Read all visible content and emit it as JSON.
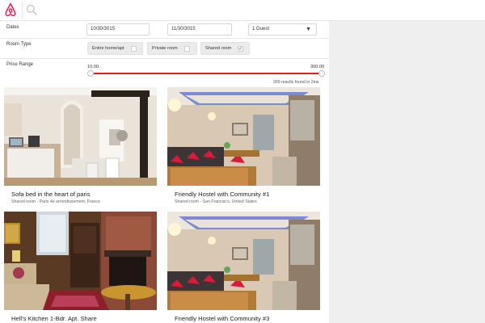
{
  "app": {
    "logo_icon": "airbnb-logo-icon",
    "search_icon": "search-icon",
    "accent_color": "#e02020"
  },
  "filters": {
    "dates": {
      "label": "Dates",
      "check_in": "10/30/3015",
      "check_out": "11/30/3015",
      "guests": "1 Guest"
    },
    "room_type": {
      "label": "Room Type",
      "options": [
        {
          "label": "Entire home/apt",
          "checked": false
        },
        {
          "label": "Private room",
          "checked": false
        },
        {
          "label": "Shared room",
          "checked": true,
          "check_glyph": "✓"
        }
      ]
    },
    "price_range": {
      "label": "Price Range",
      "min": "10.00",
      "max": "300.00"
    },
    "results_count": "309 results found in 2ms"
  },
  "listings": [
    {
      "title": "Sofa bed in the heart of paris",
      "subtitle": "Shared room - Paris 4e arrondissement, France"
    },
    {
      "title": "Friendly Hostel with Community #1",
      "subtitle": "Shared room - San Francisco, United States"
    },
    {
      "title": "Hell's Kitchen 1-Bdr. Apt. Share",
      "subtitle": ""
    },
    {
      "title": "Friendly Hostel with Community #3",
      "subtitle": ""
    }
  ]
}
